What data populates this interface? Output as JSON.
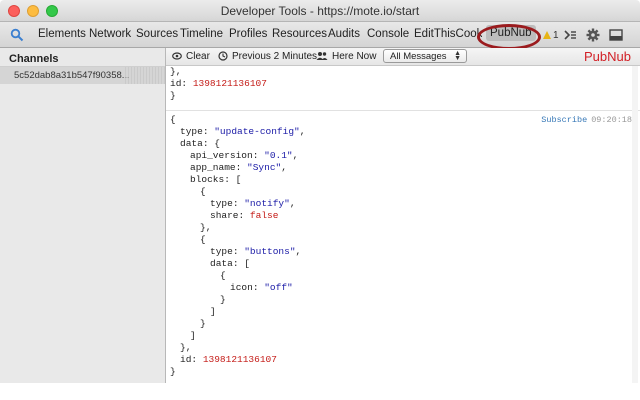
{
  "window": {
    "title": "Developer Tools - https://mote.io/start"
  },
  "toolbar": {
    "tabs": [
      {
        "label": "Elements"
      },
      {
        "label": "Network"
      },
      {
        "label": "Sources"
      },
      {
        "label": "Timeline"
      },
      {
        "label": "Profiles"
      },
      {
        "label": "Resources"
      },
      {
        "label": "Audits"
      },
      {
        "label": "Console"
      },
      {
        "label": "EditThisCookie"
      },
      {
        "label": "PubNub"
      }
    ],
    "active_tab": "PubNub",
    "warning_count": "1",
    "icons": [
      "search-icon",
      "warning-icon",
      "console-drawer-icon",
      "gear-icon",
      "dock-icon"
    ],
    "highlight_color": "#9b1b1e"
  },
  "sidebar": {
    "heading": "Channels",
    "items": [
      {
        "label": "5c52dab8a31b547f90358..."
      }
    ]
  },
  "subtoolbar": {
    "clear_label": "Clear",
    "previous_label": "Previous 2 Minutes",
    "here_now_label": "Here Now",
    "filter_select": {
      "selected": "All Messages"
    },
    "brand": "PubNub",
    "brand_color": "#d21f26"
  },
  "messages": [
    {
      "lines": [
        {
          "indent": 0,
          "text": "},"
        },
        {
          "indent": 0,
          "key": "id",
          "value": "1398121136107",
          "vtype": "number"
        },
        {
          "indent": 0,
          "text": "}"
        }
      ]
    },
    {
      "action": "Subscribe",
      "time": "09:20:18",
      "lines": [
        {
          "indent": 0,
          "text": "{"
        },
        {
          "indent": 1,
          "key": "type",
          "value": "\"update-config\"",
          "vtype": "string",
          "suffix": ","
        },
        {
          "indent": 1,
          "key": "data",
          "text_after": "{"
        },
        {
          "indent": 2,
          "key": "api_version",
          "value": "\"0.1\"",
          "vtype": "string",
          "suffix": ","
        },
        {
          "indent": 2,
          "key": "app_name",
          "value": "\"Sync\"",
          "vtype": "string",
          "suffix": ","
        },
        {
          "indent": 2,
          "key": "blocks",
          "text_after": "["
        },
        {
          "indent": 3,
          "text": "{"
        },
        {
          "indent": 4,
          "key": "type",
          "value": "\"notify\"",
          "vtype": "string",
          "suffix": ","
        },
        {
          "indent": 4,
          "key": "share",
          "value": "false",
          "vtype": "boolean"
        },
        {
          "indent": 3,
          "text": "},"
        },
        {
          "indent": 3,
          "text": "{"
        },
        {
          "indent": 4,
          "key": "type",
          "value": "\"buttons\"",
          "vtype": "string",
          "suffix": ","
        },
        {
          "indent": 4,
          "key": "data",
          "text_after": "["
        },
        {
          "indent": 5,
          "text": "{"
        },
        {
          "indent": 6,
          "key": "icon",
          "value": "\"off\"",
          "vtype": "string"
        },
        {
          "indent": 5,
          "text": "}"
        },
        {
          "indent": 4,
          "text": "]"
        },
        {
          "indent": 3,
          "text": "}"
        },
        {
          "indent": 2,
          "text": "]"
        },
        {
          "indent": 1,
          "text": "},"
        },
        {
          "indent": 1,
          "key": "id",
          "value": "1398121136107",
          "vtype": "number"
        },
        {
          "indent": 0,
          "text": "}"
        }
      ]
    }
  ]
}
